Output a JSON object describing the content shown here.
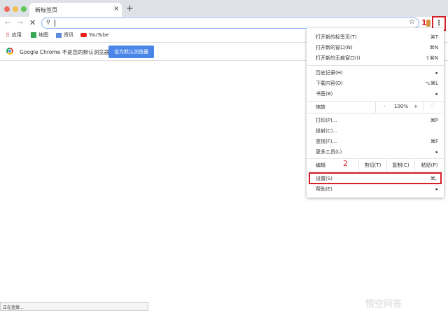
{
  "tab": {
    "title": "新标签页",
    "close": "×",
    "new_tab": "+"
  },
  "bookmarks": [
    {
      "label": "应用"
    },
    {
      "label": "地图"
    },
    {
      "label": "资讯"
    },
    {
      "label": "YouTube"
    }
  ],
  "infobar": {
    "message": "Google Chrome 不是您的默认浏览器",
    "button": "设为默认浏览器"
  },
  "annotations": {
    "step1": "1",
    "step2": "2"
  },
  "menu": {
    "items1": [
      {
        "label": "打开新的标签页(T)",
        "shortcut": "⌘T"
      },
      {
        "label": "打开新的窗口(N)",
        "shortcut": "⌘N"
      },
      {
        "label": "打开新的无痕窗口(I)",
        "shortcut": "⇧⌘N"
      }
    ],
    "items2": [
      {
        "label": "历史记录(H)",
        "shortcut": "▸"
      },
      {
        "label": "下载内容(D)",
        "shortcut": "⌥⌘L"
      },
      {
        "label": "书签(B)",
        "shortcut": "▸"
      }
    ],
    "zoom": {
      "label": "缩放",
      "minus": "-",
      "value": "100%",
      "plus": "+",
      "fullscreen": "⛶"
    },
    "items3": [
      {
        "label": "打印(P)...",
        "shortcut": "⌘P"
      },
      {
        "label": "投射(C)...",
        "shortcut": ""
      },
      {
        "label": "查找(F)...",
        "shortcut": "⌘F"
      },
      {
        "label": "更多工具(L)",
        "shortcut": "▸"
      }
    ],
    "edit": {
      "label": "编辑",
      "cut": "剪切(T)",
      "copy": "复制(C)",
      "paste": "粘贴(P)"
    },
    "settings": {
      "label": "设置(S)",
      "shortcut": "⌘,"
    },
    "help": {
      "label": "帮助(E)",
      "shortcut": "▸"
    }
  },
  "status": "正在连接...",
  "watermark": "悟空问答"
}
